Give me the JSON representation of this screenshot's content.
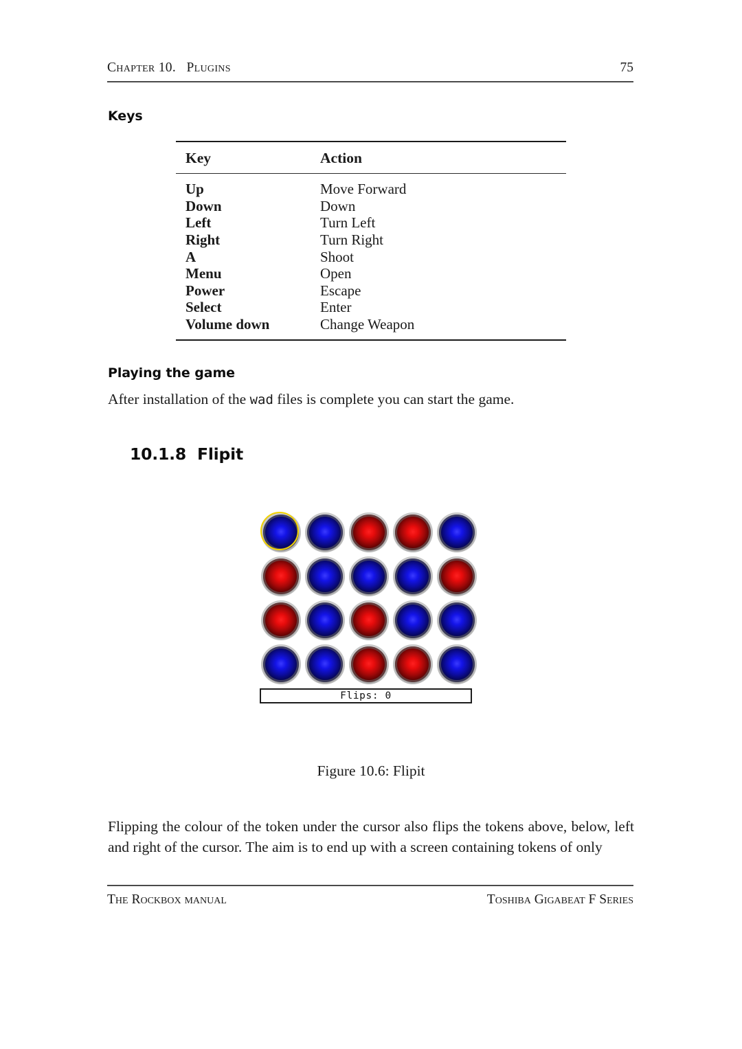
{
  "header": {
    "chapter_label": "Chapter 10.   Plugins",
    "page_number": "75"
  },
  "keys_section": {
    "heading": "Keys",
    "table": {
      "columns": [
        "Key",
        "Action"
      ],
      "rows": [
        {
          "key": "Up",
          "action": "Move Forward"
        },
        {
          "key": "Down",
          "action": "Down"
        },
        {
          "key": "Left",
          "action": "Turn Left"
        },
        {
          "key": "Right",
          "action": "Turn Right"
        },
        {
          "key": "A",
          "action": "Shoot"
        },
        {
          "key": "Menu",
          "action": "Open"
        },
        {
          "key": "Power",
          "action": "Escape"
        },
        {
          "key": "Select",
          "action": "Enter"
        },
        {
          "key": "Volume down",
          "action": "Change Weapon"
        }
      ]
    }
  },
  "playing_section": {
    "heading": "Playing the game",
    "text_before": "After installation of the ",
    "mono_term": "wad",
    "text_after": " files is complete you can start the game."
  },
  "flipit_section": {
    "number": "10.1.8",
    "title": "Flipit",
    "caption": "Figure 10.6: Flipit",
    "body": "Flipping the colour of the token under the cursor also flips the tokens above, below, left and right of the cursor.  The aim is to end up with a screen containing tokens of only"
  },
  "flipit_game": {
    "status_text": "Flips: 0",
    "colors": {
      "blue": "#1414e8",
      "red": "#e80c0c",
      "cursor_ring": "#f2d200"
    },
    "cursor": {
      "row": 0,
      "col": 0
    },
    "grid": [
      [
        "blue",
        "blue",
        "red",
        "red",
        "blue"
      ],
      [
        "red",
        "blue",
        "blue",
        "blue",
        "red"
      ],
      [
        "red",
        "blue",
        "red",
        "blue",
        "blue"
      ],
      [
        "blue",
        "blue",
        "red",
        "red",
        "blue"
      ]
    ]
  },
  "footer": {
    "left": "The Rockbox manual",
    "right": "Toshiba Gigabeat F Series"
  }
}
